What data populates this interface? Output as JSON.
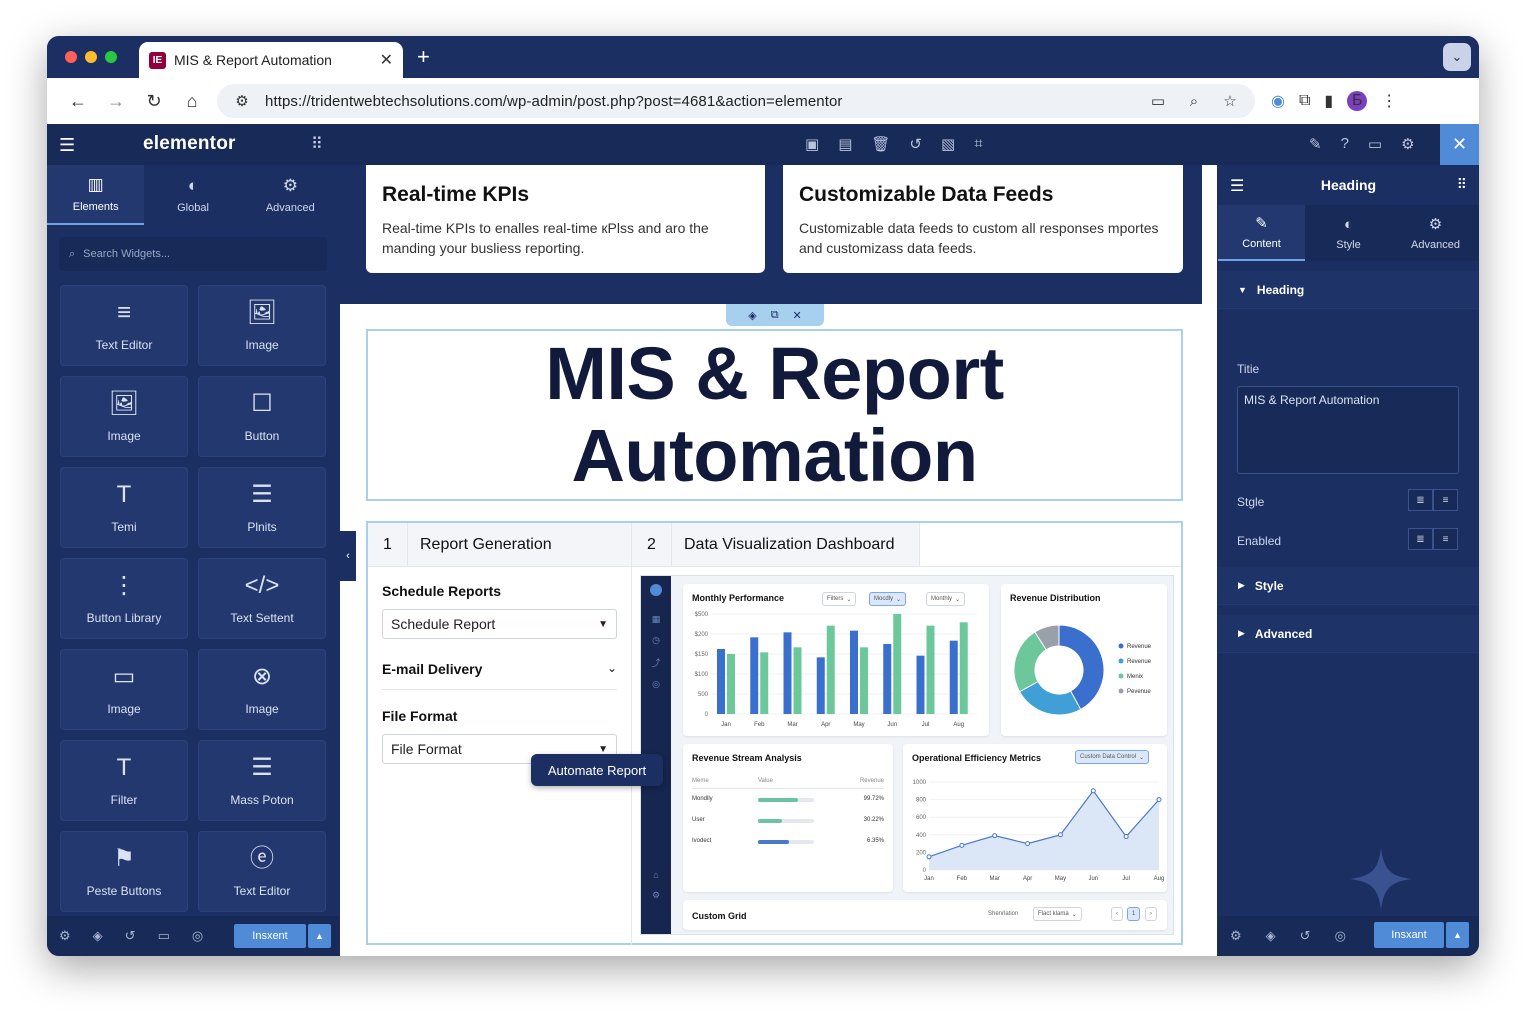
{
  "browser": {
    "tab_title": "MIS & Report Automation",
    "tab_favicon": "IE",
    "url": "https://tridentwebtechsolutions.com/wp-admin/post.php?post=4681&action=elementor",
    "profile_initial": "Б"
  },
  "editor": {
    "logo": "elementor",
    "left_tabs": [
      {
        "label": "Elements",
        "icon": "elements-icon"
      },
      {
        "label": "Global",
        "icon": "globe-icon"
      },
      {
        "label": "Advanced",
        "icon": "gear-icon"
      }
    ],
    "search_placeholder": "Search Widgets...",
    "widgets": [
      {
        "label": "Text Editor",
        "icon": "≡"
      },
      {
        "label": "Image",
        "icon": "🖼"
      },
      {
        "label": "Image",
        "icon": "🖼"
      },
      {
        "label": "Button",
        "icon": "☐"
      },
      {
        "label": "Temi",
        "icon": "T"
      },
      {
        "label": "Plnits",
        "icon": "☰"
      },
      {
        "label": "Button Library",
        "icon": "⋮"
      },
      {
        "label": "Text Settent",
        "icon": "</>"
      },
      {
        "label": "Image",
        "icon": "▭"
      },
      {
        "label": "Image",
        "icon": "⊗"
      },
      {
        "label": "Filter",
        "icon": "T"
      },
      {
        "label": "Mass Poton",
        "icon": "☰"
      },
      {
        "label": "Peste Buttons",
        "icon": "⚑"
      },
      {
        "label": "Text Editor",
        "icon": "ⓔ"
      }
    ],
    "publish_label": "Insxent"
  },
  "canvas": {
    "kpi_cards": [
      {
        "title": "Real-time KPIs",
        "text": "Real-time KPIs to enalles real-time кPlss and aro the manding your busliess reporting."
      },
      {
        "title": "Customizable Data Feeds",
        "text": "Customizable data feeds to custom all responses mportes and customizass data feeds."
      }
    ],
    "heading": "MIS & Report Automation",
    "tabs": [
      {
        "num": "1",
        "label": "Report Generation"
      },
      {
        "num": "2",
        "label": "Data Visualization Dashboard"
      }
    ],
    "form": {
      "schedule_label": "Schedule Reports",
      "schedule_value": "Schedule Report",
      "email_label": "E-mail Delivery",
      "format_label": "File Format",
      "format_value": "File Format"
    },
    "automate_button": "Automate Report"
  },
  "dashboard": {
    "monthly": {
      "title": "Monthly Performance",
      "filters": [
        "Filters",
        "Mocdly",
        "Monthly"
      ],
      "y_ticks": [
        "$500",
        "$200",
        "$150",
        "$100",
        "500",
        "0"
      ]
    },
    "revenue_dist": {
      "title": "Revenue Distribution",
      "legend": [
        "Revenue",
        "Revenue",
        "Menix",
        "Pevenue"
      ]
    },
    "revenue_stream": {
      "title": "Revenue Stream Analysis",
      "headers": [
        "Meme",
        "Value",
        "Revenue"
      ],
      "rows": [
        {
          "name": "Mondlly",
          "value": "99.72%",
          "fill": 0.72
        },
        {
          "name": "User",
          "value": "30.22%",
          "fill": 0.42
        },
        {
          "name": "Ivodect",
          "value": "6.35%",
          "fill": 0.55
        }
      ]
    },
    "operational": {
      "title": "Operational Efficiency Metrics",
      "dropdown": "Custom Data Control",
      "y_ticks": [
        "1000",
        "800",
        "600",
        "400",
        "200",
        "0"
      ]
    },
    "custom_grid": {
      "title": "Custom Grid",
      "show_label": "Shenrlation",
      "select": "Flact klama",
      "page": "1"
    }
  },
  "right_panel": {
    "title": "Heading",
    "tabs": [
      {
        "label": "Content",
        "icon": "pencil-icon"
      },
      {
        "label": "Style",
        "icon": "contrast-icon"
      },
      {
        "label": "Advanced",
        "icon": "gear-icon"
      }
    ],
    "section": "Heading",
    "title_label": "Titie",
    "title_value": "MIS & Report Automation",
    "stgle_label": "Stgle",
    "enabled_label": "Enabled",
    "style_section": "Style",
    "advanced_section": "Advanced",
    "publish_label": "Insxant"
  },
  "chart_data": [
    {
      "type": "bar",
      "title": "Monthly Performance",
      "categories": [
        "Jan",
        "Feb",
        "Mar",
        "Apr",
        "May",
        "Jun",
        "Jul",
        "Aug"
      ],
      "ylim": [
        0,
        6
      ],
      "series": [
        {
          "values": [
            3.9,
            4.6,
            4.9,
            3.4,
            5.0,
            4.2,
            3.5,
            4.4
          ]
        },
        {
          "values": [
            3.6,
            3.7,
            4.0,
            5.3,
            4.0,
            6.0,
            5.3,
            5.5
          ]
        }
      ]
    },
    {
      "type": "pie",
      "title": "Revenue Distribution",
      "labels": [
        "Revenue",
        "Revenue",
        "Menix",
        "Pevenue"
      ],
      "values": [
        42,
        25,
        24,
        9
      ]
    },
    {
      "type": "line",
      "title": "Operational Efficiency Metrics",
      "categories": [
        "Jan",
        "Feb",
        "Mar",
        "Apr",
        "May",
        "Jun",
        "Jul",
        "Aug"
      ],
      "ylim": [
        0,
        1000
      ],
      "values": [
        150,
        280,
        390,
        300,
        400,
        900,
        380,
        800
      ]
    }
  ]
}
